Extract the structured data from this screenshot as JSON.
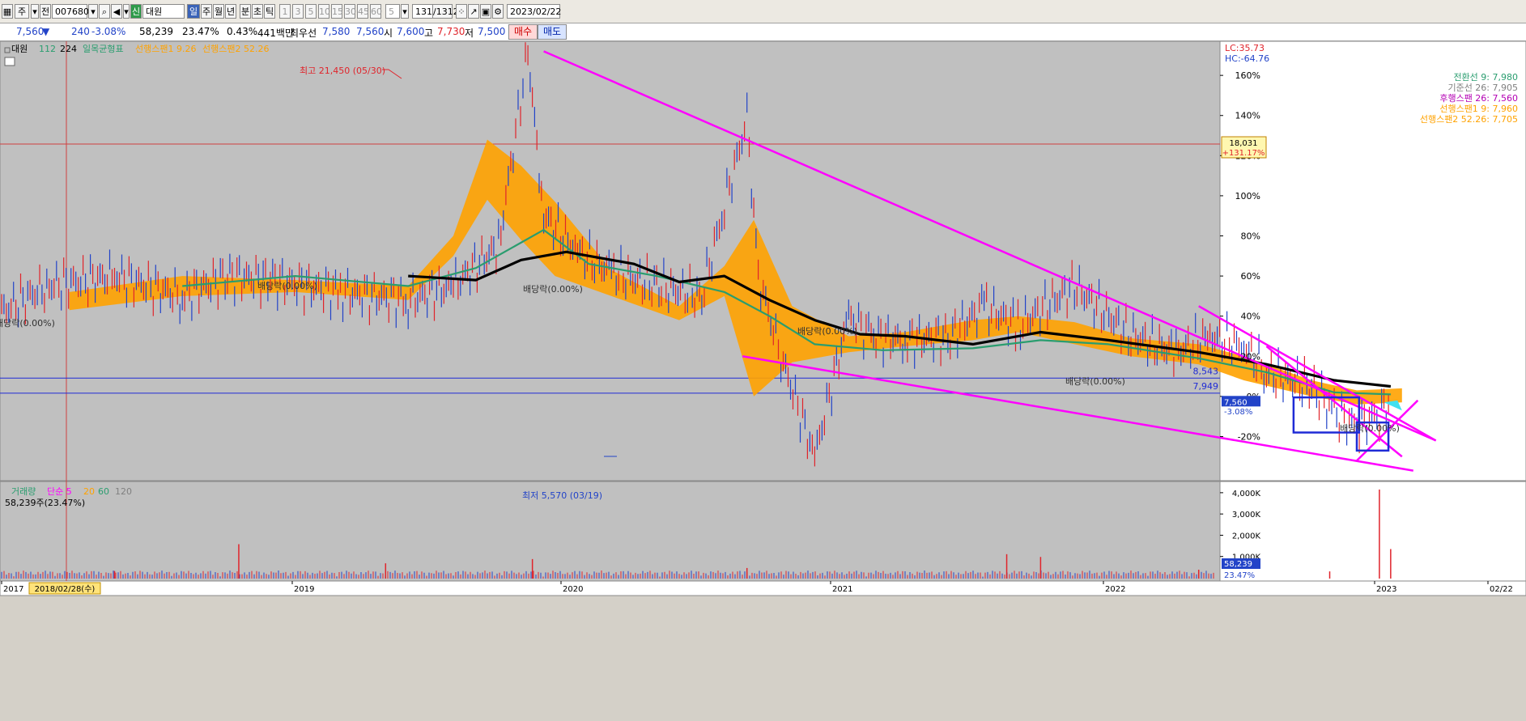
{
  "toolbar": {
    "items": [
      "주",
      "전",
      "007680",
      "대원",
      "일",
      "주",
      "월",
      "년",
      "분",
      "초",
      "틱",
      "1",
      "3",
      "5",
      "10",
      "15",
      "30",
      "45",
      "60",
      "5",
      "1312",
      "/1312",
      "2023/02/22"
    ],
    "code": "007680",
    "name": "대원",
    "period_selected": "일",
    "count": "1312",
    "total": "/1312",
    "date": "2023/02/22"
  },
  "quote": {
    "price": "7,560",
    "change": "240",
    "change_pct": "-3.08%",
    "volume": "58,239",
    "volume_pct": "23.47%",
    "turnover": "0.43%",
    "amount": "441백만",
    "best_label": "최우선",
    "best_ask": "7,580",
    "best_bid": "7,560",
    "open_label": "시",
    "open": "7,600",
    "high_label": "고",
    "high": "7,730",
    "low_label": "저",
    "low": "7,500",
    "buy": "매수",
    "sell": "매도"
  },
  "colors": {
    "up": "#e0242b",
    "down": "#2243c8",
    "ichimoku_cloud": "#ffa200",
    "trendline": "#ff00ff",
    "ma112": "#2a9d6f",
    "ma224": "#000000",
    "background": "#c0c0c0"
  },
  "chart_data": [
    {
      "type": "line",
      "legend": [
        "대원",
        "112",
        "224",
        "일목균형표",
        "선행스팬1 9.26",
        "선행스팬2 52.26"
      ],
      "right_axis_labels": [
        "LC:35.73",
        "HC:-64.76"
      ],
      "ichimoku_labels": [
        "전환선 9: 7,980",
        "기준선 26: 7,905",
        "후행스팬 26: 7,560",
        "선행스팬1 9: 7,960",
        "선행스팬2 52.26: 7,705"
      ],
      "y_ticks": [
        "160%",
        "140%",
        "120%",
        "100%",
        "80%",
        "60%",
        "40%",
        "20%",
        "0%",
        "-20%"
      ],
      "y_tick_values": [
        160,
        140,
        120,
        100,
        80,
        60,
        40,
        20,
        0,
        -20
      ],
      "ylim": [
        -42,
        177
      ],
      "x_ticks": [
        "2017",
        "2018/02/28(수)",
        "2019",
        "2020",
        "2021",
        "2022",
        "2023",
        "02/22"
      ],
      "annotations": [
        "최고 21,450 (05/30)",
        "최저 5,570 (03/19)",
        "배당락(0.00%)",
        "배당락(0.00%)",
        "배당락(0.00%)",
        "배당락(0.00%)",
        "배당락(0.00%)",
        "배당락(0.00%)"
      ],
      "price_labels": [
        "18,031",
        "+131.17%",
        "8,543",
        "7,949",
        "7,560",
        "-3.08%"
      ],
      "hlines": [
        {
          "label": "8,543",
          "value": 9.1
        },
        {
          "label": "7,949",
          "value": 1.6
        }
      ],
      "ma224_x": [
        2018.8,
        2019.1,
        2019.3,
        2019.5,
        2019.8,
        2020.0,
        2020.2,
        2020.4,
        2020.6,
        2020.8,
        2021.0,
        2021.3,
        2021.6,
        2021.9,
        2022.3,
        2022.6,
        2022.9,
        2023.15
      ],
      "ma224_y": [
        60,
        58,
        68,
        72,
        66,
        57,
        60,
        48,
        38,
        31,
        30,
        26,
        32,
        28,
        22,
        16,
        8,
        5
      ],
      "ma112_x": [
        2017.8,
        2018.3,
        2018.8,
        2019.1,
        2019.4,
        2019.6,
        2019.9,
        2020.2,
        2020.4,
        2020.6,
        2020.9,
        2021.3,
        2021.6,
        2021.9,
        2022.3,
        2022.6,
        2022.9,
        2023.15
      ],
      "ma112_y": [
        55,
        60,
        55,
        64,
        83,
        66,
        60,
        52,
        40,
        26,
        23,
        24,
        28,
        26,
        19,
        12,
        2,
        1
      ],
      "cloud_x": [
        2017.3,
        2017.8,
        2018.3,
        2018.8,
        2019.0,
        2019.15,
        2019.3,
        2019.45,
        2019.7,
        2020.0,
        2020.2,
        2020.33,
        2020.5,
        2020.75,
        2021.0,
        2021.3,
        2021.5,
        2021.75,
        2022.0,
        2022.3,
        2022.5,
        2022.8,
        2023.0,
        2023.2
      ],
      "cloud_hi": [
        52,
        60,
        58,
        55,
        80,
        128,
        115,
        97,
        63,
        45,
        65,
        88,
        45,
        30,
        32,
        38,
        40,
        37,
        29,
        26,
        20,
        8,
        3,
        4
      ],
      "cloud_lo": [
        43,
        50,
        52,
        48,
        70,
        98,
        78,
        60,
        50,
        38,
        50,
        0,
        17,
        22,
        25,
        28,
        32,
        26,
        20,
        16,
        8,
        0,
        -4,
        -3
      ],
      "price_x": [
        2017.0,
        2017.2,
        2017.5,
        2017.8,
        2018.0,
        2018.2,
        2018.5,
        2018.8,
        2019.0,
        2019.2,
        2019.33,
        2019.4,
        2019.55,
        2019.7,
        2019.9,
        2020.1,
        2020.2,
        2020.3,
        2020.35,
        2020.45,
        2020.6,
        2020.75,
        2020.85,
        2021.0,
        2021.2,
        2021.35,
        2021.5,
        2021.75,
        2022.0,
        2022.2,
        2022.35,
        2022.5,
        2022.6,
        2022.8,
        2022.9,
        2023.0,
        2023.1,
        2023.15
      ],
      "price_y": [
        42,
        55,
        60,
        50,
        60,
        58,
        52,
        48,
        55,
        75,
        172,
        90,
        72,
        62,
        55,
        50,
        95,
        138,
        60,
        20,
        -30,
        40,
        30,
        28,
        30,
        45,
        35,
        55,
        30,
        22,
        30,
        25,
        12,
        5,
        -8,
        -15,
        -8,
        -3
      ],
      "volume": {
        "labels": [
          "거래량",
          "단순 5",
          "20",
          "60",
          "120"
        ],
        "total": "58,239주(23.47%)",
        "y_ticks": [
          "4,000K",
          "3,000K",
          "2,000K",
          "1,000K"
        ],
        "y_tick_values": [
          4000,
          3000,
          2000,
          1000
        ],
        "current": "58,239",
        "current_pct": "23.47%",
        "spikes_x": [
          2017.5,
          2018.05,
          2018.7,
          2019.35,
          2020.3,
          2021.45,
          2021.6,
          2022.3,
          2022.88,
          2023.1,
          2023.15
        ],
        "spikes_v": [
          320,
          1580,
          680,
          880,
          460,
          1110,
          980,
          380,
          300,
          4150,
          1350
        ]
      }
    }
  ]
}
